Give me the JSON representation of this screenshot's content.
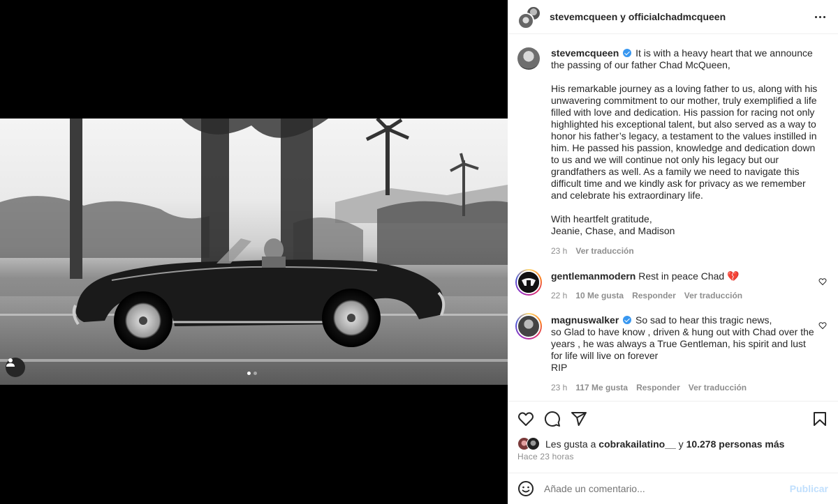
{
  "header": {
    "user1": "stevemcqueen",
    "conj": "y",
    "user2": "officialchadmcqueen"
  },
  "caption": {
    "username": "stevemcqueen",
    "first_line": "It is with a heavy heart that we announce",
    "text": "the passing of our father Chad McQueen,\n\nHis remarkable journey as a loving father to us, along with his\nunwavering commitment to our mother, truly exemplified a life\nfilled with love and dedication. His passion for racing not only\nhighlighted his exceptional talent, but also served as a way to\nhonor his father’s legacy, a testament to the values instilled in\nhim. He passed his passion, knowledge and dedication down\nto us and we will continue not only his legacy but our\ngrandfathers as well. As a family we need to navigate this\ndifficult time and we kindly ask for privacy as we remember\nand celebrate his extraordinary life.\n\nWith heartfelt gratitude,\nJeanie, Chase, and Madison",
    "time": "23 h",
    "translate": "Ver traducción"
  },
  "comments": [
    {
      "username": "gentlemanmodern",
      "text": "Rest in peace Chad 💔",
      "time": "22 h",
      "likes": "10 Me gusta",
      "reply": "Responder",
      "translate": "Ver traducción"
    },
    {
      "username": "magnuswalker",
      "first_line": "So sad to hear this tragic news,",
      "text": "so Glad to have know , driven & hung out with Chad over the\nyears , he was always a True Gentleman, his spirit and lust\nfor life will live on forever\nRIP",
      "time": "23 h",
      "likes": "117 Me gusta",
      "reply": "Responder",
      "translate": "Ver traducción"
    }
  ],
  "likes": {
    "prefix": "Les gusta a",
    "user": "cobrakailatino__",
    "middle": "y",
    "count": "10.278 personas más"
  },
  "time_ago": "Hace 23 horas",
  "add_comment": {
    "placeholder": "Añade un comentario...",
    "post_label": "Publicar"
  },
  "carousel": {
    "current": 1,
    "total": 2
  },
  "icons": [
    "tag-user-icon",
    "more-options-icon",
    "verified-icon",
    "heart-icon",
    "comment-icon",
    "share-icon",
    "bookmark-icon",
    "emoji-icon"
  ],
  "colors": {
    "verified": "#3897f0",
    "muted": "#8e8e8e",
    "post_disabled": "#c0dffd"
  }
}
